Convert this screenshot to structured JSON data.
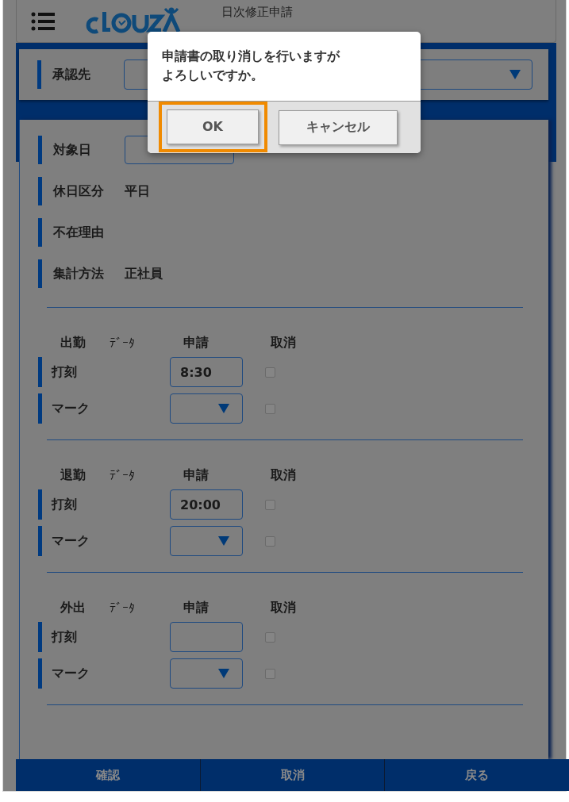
{
  "header": {
    "title": "日次修正申請"
  },
  "approver": {
    "label": "承認先"
  },
  "fields": [
    {
      "label": "対象日",
      "kind": "date"
    },
    {
      "label": "休日区分",
      "kind": "text",
      "value": "平日"
    },
    {
      "label": "不在理由",
      "kind": "text"
    },
    {
      "label": "集計方法",
      "kind": "text",
      "value": "正社員"
    }
  ],
  "sections": [
    {
      "name": "出勤",
      "data_col": "ﾃﾞｰﾀ",
      "request_col": "申請",
      "cancel_col": "取消",
      "rows": [
        {
          "label": "打刻",
          "kind": "time",
          "value": "8:30",
          "checked": false
        },
        {
          "label": "マーク",
          "kind": "select",
          "checked": false
        }
      ]
    },
    {
      "name": "退勤",
      "data_col": "ﾃﾞｰﾀ",
      "request_col": "申請",
      "cancel_col": "取消",
      "rows": [
        {
          "label": "打刻",
          "kind": "time",
          "value": "20:00",
          "checked": false
        },
        {
          "label": "マーク",
          "kind": "select",
          "checked": false
        }
      ]
    },
    {
      "name": "外出",
      "data_col": "ﾃﾞｰﾀ",
      "request_col": "申請",
      "cancel_col": "取消",
      "rows": [
        {
          "label": "打刻",
          "kind": "time",
          "checked": false
        },
        {
          "label": "マーク",
          "kind": "select",
          "checked": false
        }
      ]
    }
  ],
  "footer": [
    {
      "label": "確認"
    },
    {
      "label": "取消"
    },
    {
      "label": "戻る"
    }
  ],
  "dialog": {
    "message_lines": [
      "申請書の取り消しを行いますが",
      "よろしいですか。"
    ],
    "buttons": [
      {
        "label": "OK",
        "focused": true
      },
      {
        "label": "キャンセル",
        "focused": false
      }
    ]
  }
}
